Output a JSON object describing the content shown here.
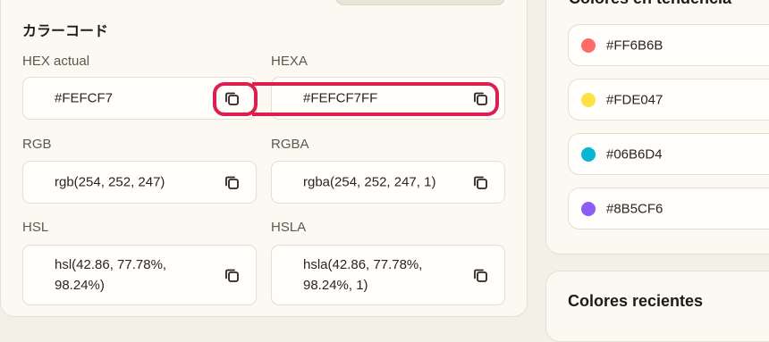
{
  "converter": {
    "title": "カラーコード",
    "fields": [
      {
        "label": "HEX actual",
        "value": "#FEFCF7"
      },
      {
        "label": "HEXA",
        "value": "#FEFCF7FF"
      },
      {
        "label": "RGB",
        "value": "rgb(254, 252, 247)"
      },
      {
        "label": "RGBA",
        "value": "rgba(254, 252, 247, 1)"
      },
      {
        "label": "HSL",
        "value": "hsl(42.86, 77.78%,\n98.24%)"
      },
      {
        "label": "HSLA",
        "value": "hsla(42.86, 77.78%,\n98.24%, 1)"
      }
    ],
    "copy_icon": "copy-icon"
  },
  "trending": {
    "title": "Colores en tendencia",
    "items": [
      {
        "label": "#FF6B6B",
        "color": "#FF6B6B"
      },
      {
        "label": "#FDE047",
        "color": "#FDE047"
      },
      {
        "label": "#06B6D4",
        "color": "#06B6D4"
      },
      {
        "label": "#8B5CF6",
        "color": "#8B5CF6"
      }
    ]
  },
  "recent": {
    "title": "Colores recientes"
  },
  "colors": {
    "highlight": "#DC1F4D",
    "background": "#FEFCF7"
  }
}
